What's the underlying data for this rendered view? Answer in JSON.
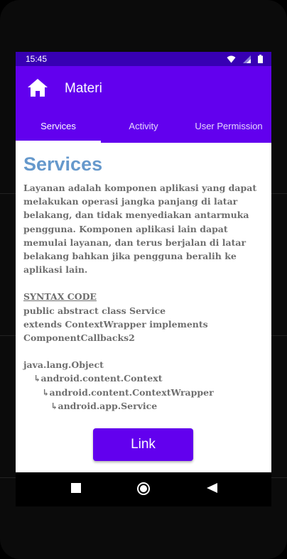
{
  "status_bar": {
    "time": "15:45",
    "icons": [
      "wifi-icon",
      "signal-icon",
      "battery-icon"
    ]
  },
  "app_bar": {
    "home_icon": "home-icon",
    "title": "Materi"
  },
  "tabs": [
    {
      "label": "Services",
      "active": true
    },
    {
      "label": "Activity",
      "active": false
    },
    {
      "label": "User Permission",
      "active": false
    }
  ],
  "content": {
    "heading": "Services",
    "description": "Layanan adalah komponen aplikasi yang dapat melakukan operasi jangka panjang di latar belakang, dan tidak menyediakan antarmuka pengguna. Komponen aplikasi lain dapat memulai layanan, dan terus berjalan di latar belakang bahkan jika pengguna beralih ke aplikasi lain.",
    "syntax_title": "SYNTAX CODE",
    "syntax_lines": [
      "public abstract class Service",
      "extends ContextWrapper implements",
      "ComponentCallbacks2"
    ],
    "hierarchy": [
      "java.lang.Object",
      "↳android.content.Context",
      "↳android.content.ContextWrapper",
      "↳android.app.Service"
    ]
  },
  "link_button": {
    "label": "Link"
  },
  "nav_bar": {
    "icons": [
      "recent-apps-icon",
      "home-circle-icon",
      "back-icon"
    ]
  },
  "colors": {
    "primary": "#6200ee",
    "primary_dark": "#3700b3",
    "heading": "#6699cc",
    "body_text": "#6e6e6e"
  }
}
